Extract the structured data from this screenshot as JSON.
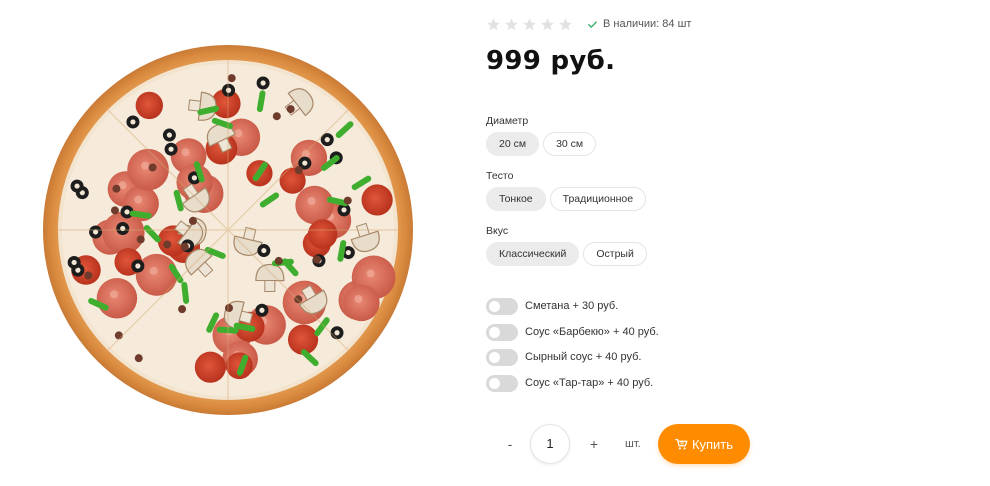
{
  "product": {
    "image_alt": "pizza-image",
    "rating": {
      "value": 0,
      "max": 5
    },
    "availability_text": "В наличии: 84 шт",
    "price": "999 руб."
  },
  "options": {
    "diameter": {
      "label": "Диаметр",
      "choices": [
        "20 см",
        "30 см"
      ],
      "selected": "20 см"
    },
    "dough": {
      "label": "Тесто",
      "choices": [
        "Тонкое",
        "Традиционное"
      ],
      "selected": "Тонкое"
    },
    "flavor": {
      "label": "Вкус",
      "choices": [
        "Классический",
        "Острый"
      ],
      "selected": "Классический"
    }
  },
  "addons": [
    {
      "label": "Сметана + 30 руб.",
      "enabled": false
    },
    {
      "label": "Соус «Барбекю» + 40 руб.",
      "enabled": false
    },
    {
      "label": "Сырный соус + 40 руб.",
      "enabled": false
    },
    {
      "label": "Соус «Тар-тар» + 40 руб.",
      "enabled": false
    }
  ],
  "purchase": {
    "minus": "-",
    "quantity": "1",
    "plus": "+",
    "unit": "шт.",
    "buy_label": "Купить"
  },
  "colors": {
    "accent": "#ff8c00",
    "availability_check": "#3cb371",
    "star_inactive": "#e2e2e2",
    "pill_active": "#ebebeb",
    "toggle_off": "#d9d9d9"
  }
}
